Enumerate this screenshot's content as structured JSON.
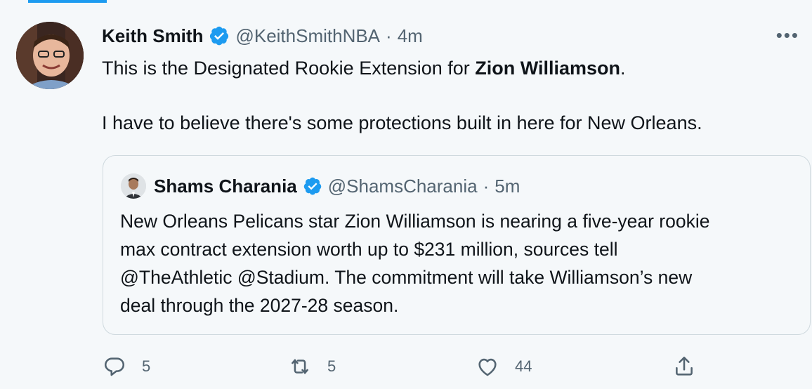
{
  "tweet": {
    "author_name": "Keith Smith",
    "author_handle": "@KeithSmithNBA",
    "separator": "·",
    "time": "4m",
    "text_prefix": "This is the Designated Rookie Extension for ",
    "text_bold": "Zion Williamson",
    "text_suffix": ".",
    "text_line2": "I have to believe there's some protections built in here for New Orleans.",
    "more_label": "•••"
  },
  "quoted": {
    "author_name": "Shams Charania",
    "author_handle": "@ShamsCharania",
    "separator": "·",
    "time": "5m",
    "lines": [
      "New Orleans Pelicans star Zion Williamson is nearing a five-year rookie",
      "max contract extension worth up to $231 million, sources tell",
      "@TheAthletic @Stadium. The commitment will take Williamson’s new",
      "deal through the 2027-28 season."
    ]
  },
  "actions": {
    "reply_count": "5",
    "retweet_count": "5",
    "like_count": "44"
  },
  "colors": {
    "verified": "#1d9bf0",
    "secondary_text": "#536471",
    "border": "#cfd9de"
  },
  "icons": {
    "verified": "verified-badge-icon",
    "more": "more-dots-icon",
    "reply": "reply-icon",
    "retweet": "retweet-icon",
    "like": "heart-icon",
    "share": "share-icon"
  }
}
